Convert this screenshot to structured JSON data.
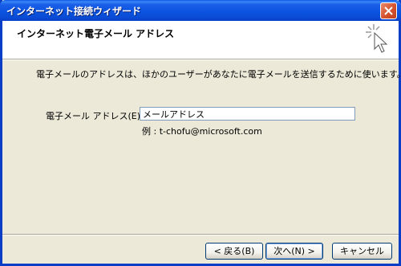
{
  "window": {
    "title": "インターネット接続ウィザード"
  },
  "header": {
    "title": "インターネット電子メール アドレス"
  },
  "main": {
    "description": "電子メールのアドレスは、ほかのユーザーがあなたに電子メールを送信するために使います。",
    "email_label": "電子メール アドレス(E):",
    "email_value": "メールアドレス",
    "example": "例 : t-chofu@microsoft.com"
  },
  "buttons": {
    "back": "< 戻る(B)",
    "next": "次へ(N) >",
    "cancel": "キャンセル"
  },
  "colors": {
    "titlebar": "#0A52DE",
    "close_button": "#D5532E",
    "background": "#ECE9D8"
  },
  "icons": [
    "close-icon",
    "wizard-icon"
  ]
}
